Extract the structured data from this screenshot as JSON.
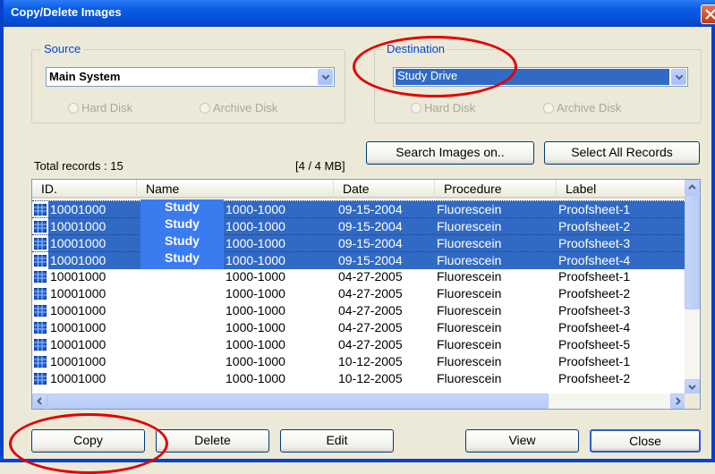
{
  "window": {
    "title": "Copy/Delete Images"
  },
  "source": {
    "legend": "Source",
    "combo_value": "Main System",
    "radios": [
      "Hard Disk",
      "Archive Disk"
    ]
  },
  "destination": {
    "legend": "Destination",
    "combo_value": "Study Drive",
    "radios": [
      "Hard Disk",
      "Archive Disk"
    ]
  },
  "buttons": {
    "search": "Search Images on..",
    "select_all": "Select All Records",
    "copy": "Copy",
    "delete": "Delete",
    "edit": "Edit",
    "view": "View",
    "close": "Close"
  },
  "status": {
    "total_records": "Total records : 15",
    "size": "[4 / 4 MB]"
  },
  "table": {
    "columns": [
      "ID.",
      "Name",
      "",
      "Date",
      "Procedure",
      "Label"
    ],
    "rows": [
      {
        "id": "10001000",
        "name": "Study",
        "num": "1000-1000",
        "date": "09-15-2004",
        "procedure": "Fluorescein",
        "label": "Proofsheet-1",
        "selected": true
      },
      {
        "id": "10001000",
        "name": "Study",
        "num": "1000-1000",
        "date": "09-15-2004",
        "procedure": "Fluorescein",
        "label": "Proofsheet-2",
        "selected": true
      },
      {
        "id": "10001000",
        "name": "Study",
        "num": "1000-1000",
        "date": "09-15-2004",
        "procedure": "Fluorescein",
        "label": "Proofsheet-3",
        "selected": true
      },
      {
        "id": "10001000",
        "name": "Study",
        "num": "1000-1000",
        "date": "09-15-2004",
        "procedure": "Fluorescein",
        "label": "Proofsheet-4",
        "selected": true
      },
      {
        "id": "10001000",
        "name": "",
        "num": "1000-1000",
        "date": "04-27-2005",
        "procedure": "Fluorescein",
        "label": "Proofsheet-1",
        "selected": false
      },
      {
        "id": "10001000",
        "name": "",
        "num": "1000-1000",
        "date": "04-27-2005",
        "procedure": "Fluorescein",
        "label": "Proofsheet-2",
        "selected": false
      },
      {
        "id": "10001000",
        "name": "",
        "num": "1000-1000",
        "date": "04-27-2005",
        "procedure": "Fluorescein",
        "label": "Proofsheet-3",
        "selected": false
      },
      {
        "id": "10001000",
        "name": "",
        "num": "1000-1000",
        "date": "04-27-2005",
        "procedure": "Fluorescein",
        "label": "Proofsheet-4",
        "selected": false
      },
      {
        "id": "10001000",
        "name": "",
        "num": "1000-1000",
        "date": "04-27-2005",
        "procedure": "Fluorescein",
        "label": "Proofsheet-5",
        "selected": false
      },
      {
        "id": "10001000",
        "name": "",
        "num": "1000-1000",
        "date": "10-12-2005",
        "procedure": "Fluorescein",
        "label": "Proofsheet-1",
        "selected": false
      },
      {
        "id": "10001000",
        "name": "",
        "num": "1000-1000",
        "date": "10-12-2005",
        "procedure": "Fluorescein",
        "label": "Proofsheet-2",
        "selected": false
      }
    ]
  },
  "icons": {
    "row": "grid-image-icon",
    "close": "close-icon",
    "combo_arrow": "chevron-down-icon"
  },
  "colors": {
    "selection": "#316AC5",
    "title_bar": "#0A5FE6",
    "annotation": "#E30000",
    "legend_text": "#0046D5"
  }
}
